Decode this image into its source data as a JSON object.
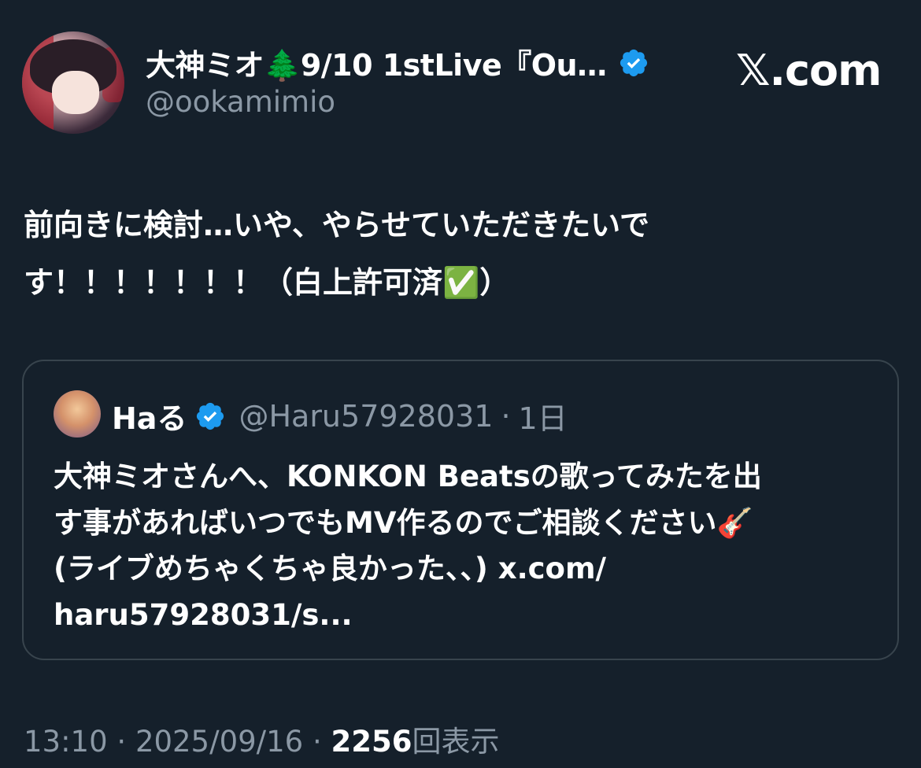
{
  "author": {
    "display_name": "大神ミオ🌲9/10 1stLive『Ou…",
    "handle": "@ookamimio",
    "avatar_icon": "avatar-image",
    "verified_icon": "verified-badge-icon"
  },
  "brand": {
    "logo_text": "𝕏.com"
  },
  "tweet": {
    "text": "前向きに検討…いや、やらせていただきたいで\nす！！！！！！！（白上許可済✅）"
  },
  "quote": {
    "author_name": "Haる",
    "handle": "@Haru57928031",
    "separator": "·",
    "time": "1日",
    "text": "大神ミオさんへ、KONKON Beatsの歌ってみたを出\nす事があればいつでもMV作るのでご相談ください🎸\n(ライブめちゃくちゃ良かった、、) x.com/\nharu57928031/s..."
  },
  "footer": {
    "time": "13:10",
    "sep1": " · ",
    "date": "2025/09/16",
    "sep2": " · ",
    "views_count": "2256",
    "views_label": "回表示"
  },
  "colors": {
    "background": "#15202b",
    "secondary_text": "#8b98a5",
    "verified_blue": "#1d9bf0",
    "border": "#38444d"
  }
}
